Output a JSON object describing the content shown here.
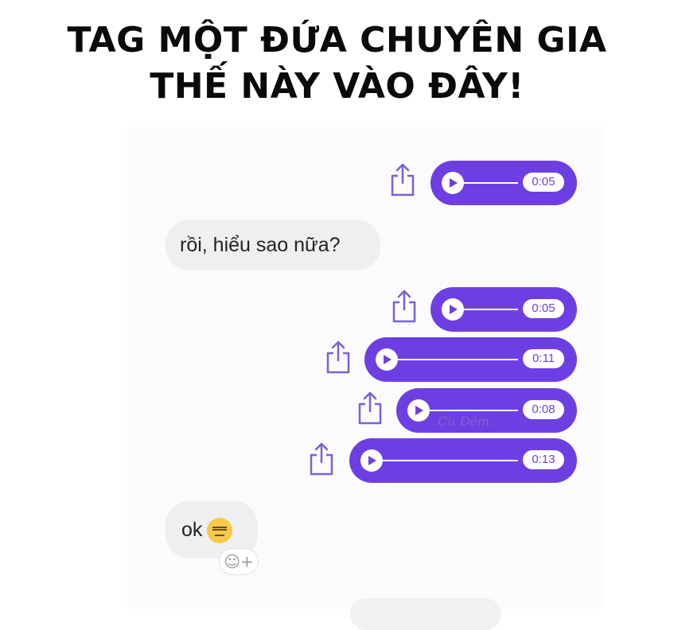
{
  "caption": {
    "line1": "TAG MỘT ĐỨA CHUYÊN GIA",
    "line2": "THẾ NÀY VÀO ĐÂY!"
  },
  "messages": [
    {
      "type": "voice",
      "sender": "me",
      "duration": "0:05"
    },
    {
      "type": "text",
      "sender": "other",
      "text": "rồi, hiểu sao nữa?"
    },
    {
      "type": "voice",
      "sender": "me",
      "duration": "0:05"
    },
    {
      "type": "voice",
      "sender": "me",
      "duration": "0:11"
    },
    {
      "type": "voice",
      "sender": "me",
      "duration": "0:08"
    },
    {
      "type": "voice",
      "sender": "me",
      "duration": "0:13"
    },
    {
      "type": "text",
      "sender": "other",
      "text": "ok",
      "emoji": "expressionless-face"
    }
  ],
  "reaction_button": {
    "icon": "add-reaction-icon",
    "label": "☺+"
  },
  "watermark": "Cú Đêm",
  "colors": {
    "voice_bubble": "#6d3fe3",
    "incoming_bubble": "#efeff1",
    "share_icon": "#7b5fd9"
  }
}
